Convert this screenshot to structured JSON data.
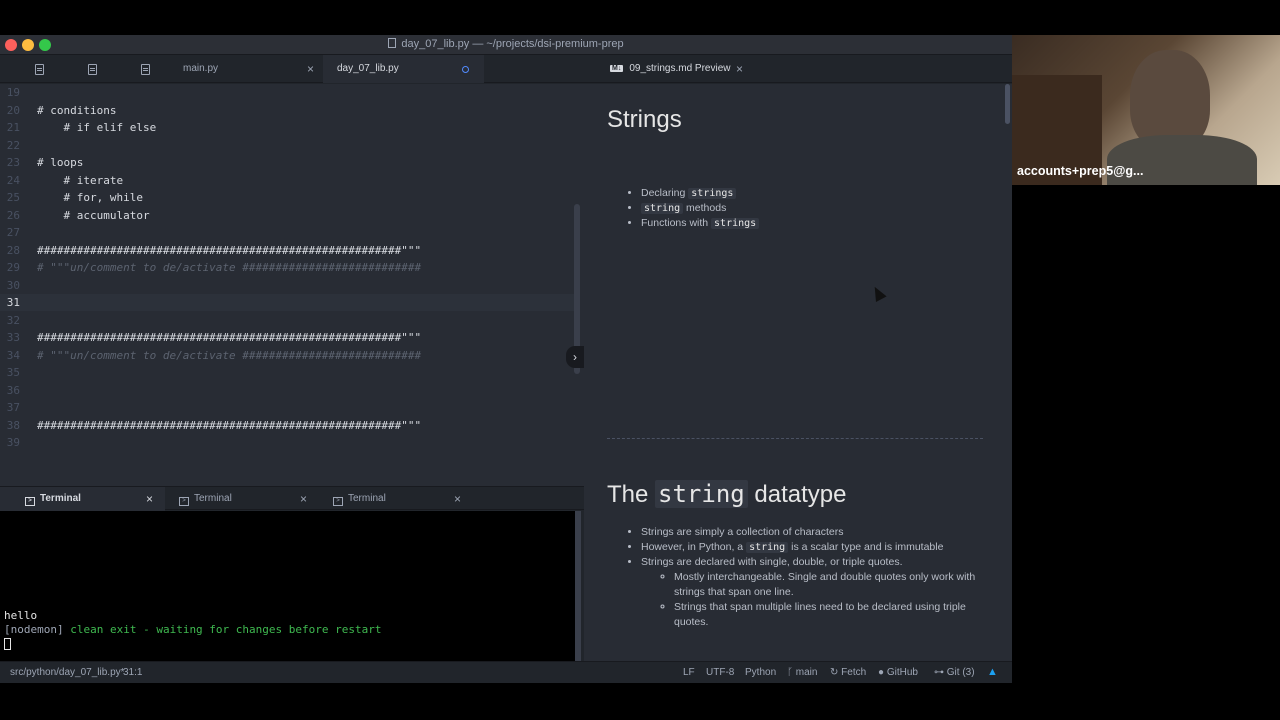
{
  "window": {
    "title": "day_07_lib.py — ~/projects/dsi-premium-prep"
  },
  "tabs_left": [
    {
      "label": "main.py",
      "active": false
    },
    {
      "label": "day_07_lib.py",
      "active": true,
      "modified": true
    }
  ],
  "tabs_right": [
    {
      "label": "09_strings.md Preview",
      "active": true
    }
  ],
  "editor": {
    "lines": [
      {
        "n": "19",
        "text": ""
      },
      {
        "n": "20",
        "text": "# conditions"
      },
      {
        "n": "21",
        "text": "    # if elif else"
      },
      {
        "n": "22",
        "text": ""
      },
      {
        "n": "23",
        "text": "# loops"
      },
      {
        "n": "24",
        "text": "    # iterate"
      },
      {
        "n": "25",
        "text": "    # for, while"
      },
      {
        "n": "26",
        "text": "    # accumulator"
      },
      {
        "n": "27",
        "text": ""
      },
      {
        "n": "28",
        "text": "#######################################################\"\"\""
      },
      {
        "n": "29",
        "text": "# \"\"\"un/comment to de/activate ###########################"
      },
      {
        "n": "30",
        "text": ""
      },
      {
        "n": "31",
        "text": ""
      },
      {
        "n": "32",
        "text": ""
      },
      {
        "n": "33",
        "text": "#######################################################\"\"\""
      },
      {
        "n": "34",
        "text": "# \"\"\"un/comment to de/activate ###########################"
      },
      {
        "n": "35",
        "text": ""
      },
      {
        "n": "36",
        "text": ""
      },
      {
        "n": "37",
        "text": ""
      },
      {
        "n": "38",
        "text": "#######################################################\"\"\""
      },
      {
        "n": "39",
        "text": ""
      }
    ]
  },
  "terminal_tabs": [
    {
      "label": "Terminal",
      "active": true
    },
    {
      "label": "Terminal",
      "active": false
    },
    {
      "label": "Terminal",
      "active": false
    }
  ],
  "terminal": {
    "output_line1": "hello",
    "output_tag": "[nodemon]",
    "output_line2": " clean exit - waiting for changes before restart"
  },
  "preview": {
    "heading1": "Strings",
    "list1": [
      {
        "pre": "Declaring ",
        "code": "strings",
        "post": ""
      },
      {
        "pre": "",
        "code": "string",
        "post": " methods"
      },
      {
        "pre": "Functions with ",
        "code": "strings",
        "post": ""
      }
    ],
    "heading2_pre": "The ",
    "heading2_code": "string",
    "heading2_post": " datatype",
    "list2_item1": "Strings are simply a collection of characters",
    "list2_item2_pre": "However, in Python, a ",
    "list2_item2_code": "string",
    "list2_item2_post": " is a scalar type and is immutable",
    "list2_item3": "Strings are declared with single, double, or triple quotes.",
    "sub_item1": "Mostly interchangeable. Single and double quotes only work with strings that span one line.",
    "sub_item2": "Strings that span multiple lines need to be declared using triple quotes."
  },
  "statusbar": {
    "path": "src/python/day_07_lib.py*",
    "cursor": "31:1",
    "line_ending": "LF",
    "encoding": "UTF-8",
    "grammar": "Python",
    "branch": "main",
    "fetch": "Fetch",
    "github": "GitHub",
    "git": "Git (3)"
  },
  "webcam": {
    "label": "accounts+prep5@g..."
  },
  "colors": {
    "editor_bg": "#282c34",
    "chrome_bg": "#21252b",
    "accent": "#528bff",
    "terminal_green": "#3fb950"
  }
}
